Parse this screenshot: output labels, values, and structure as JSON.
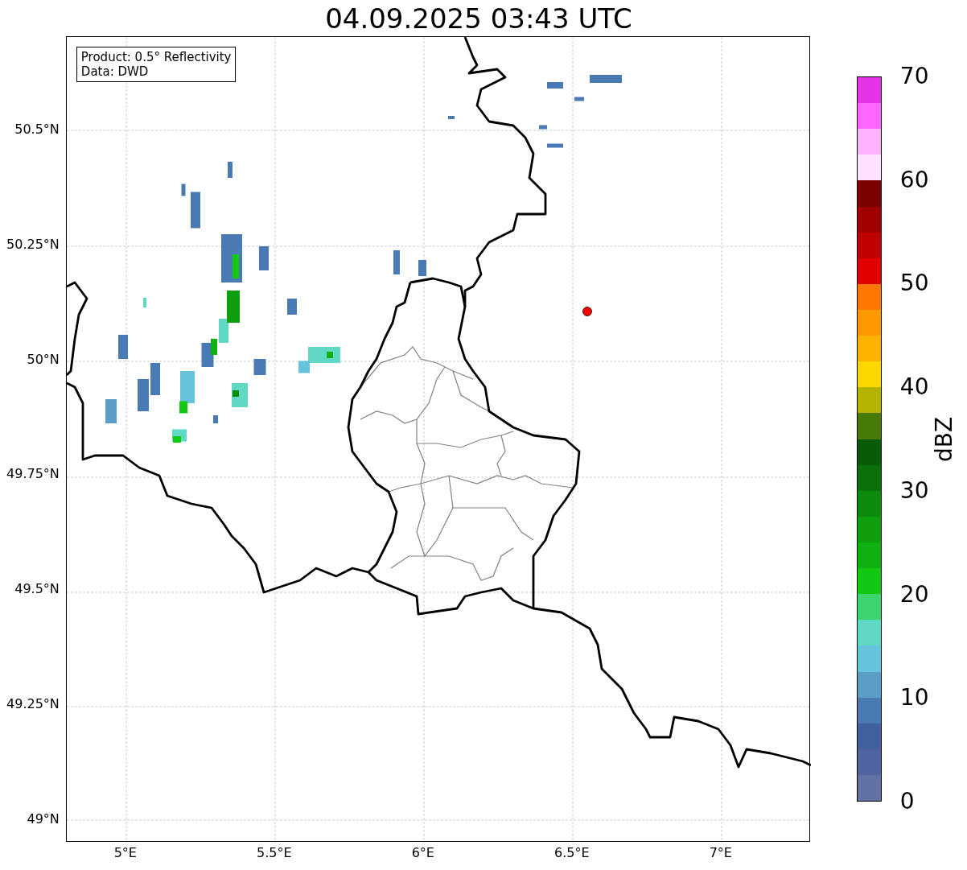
{
  "title": "04.09.2025 03:43 UTC",
  "legend": {
    "lines": [
      "Product: 0.5° Reflectivity",
      "Data: DWD"
    ]
  },
  "map": {
    "yticks": [
      "50.5°N",
      "50.25°N",
      "50°N",
      "49.75°N",
      "49.5°N",
      "49.25°N",
      "49°N"
    ],
    "xticks": [
      "5°E",
      "5.5°E",
      "6°E",
      "6.5°E",
      "7°E"
    ]
  },
  "colorbar": {
    "label": "dBZ",
    "ticks": [
      "70",
      "60",
      "50",
      "40",
      "30",
      "20",
      "10",
      "0"
    ],
    "segments": [
      {
        "color": "#e633e6"
      },
      {
        "color": "#ff66ff"
      },
      {
        "color": "#ffb3ff"
      },
      {
        "color": "#ffe0ff"
      },
      {
        "color": "#7a0000"
      },
      {
        "color": "#a00000"
      },
      {
        "color": "#c00000"
      },
      {
        "color": "#e00000"
      },
      {
        "color": "#ff7700"
      },
      {
        "color": "#ff9900"
      },
      {
        "color": "#ffb300"
      },
      {
        "color": "#ffd700"
      },
      {
        "color": "#b3b300"
      },
      {
        "color": "#487a0a"
      },
      {
        "color": "#085c08"
      },
      {
        "color": "#0a700a"
      },
      {
        "color": "#0c8a0c"
      },
      {
        "color": "#0e9e0e"
      },
      {
        "color": "#10b010"
      },
      {
        "color": "#12c812"
      },
      {
        "color": "#3cd46c"
      },
      {
        "color": "#5fd8c4"
      },
      {
        "color": "#65c3dc"
      },
      {
        "color": "#5a9ec8"
      },
      {
        "color": "#4a7ab4"
      },
      {
        "color": "#4060a0"
      },
      {
        "color": "#5064a0"
      },
      {
        "color": "#6272a4"
      }
    ]
  }
}
